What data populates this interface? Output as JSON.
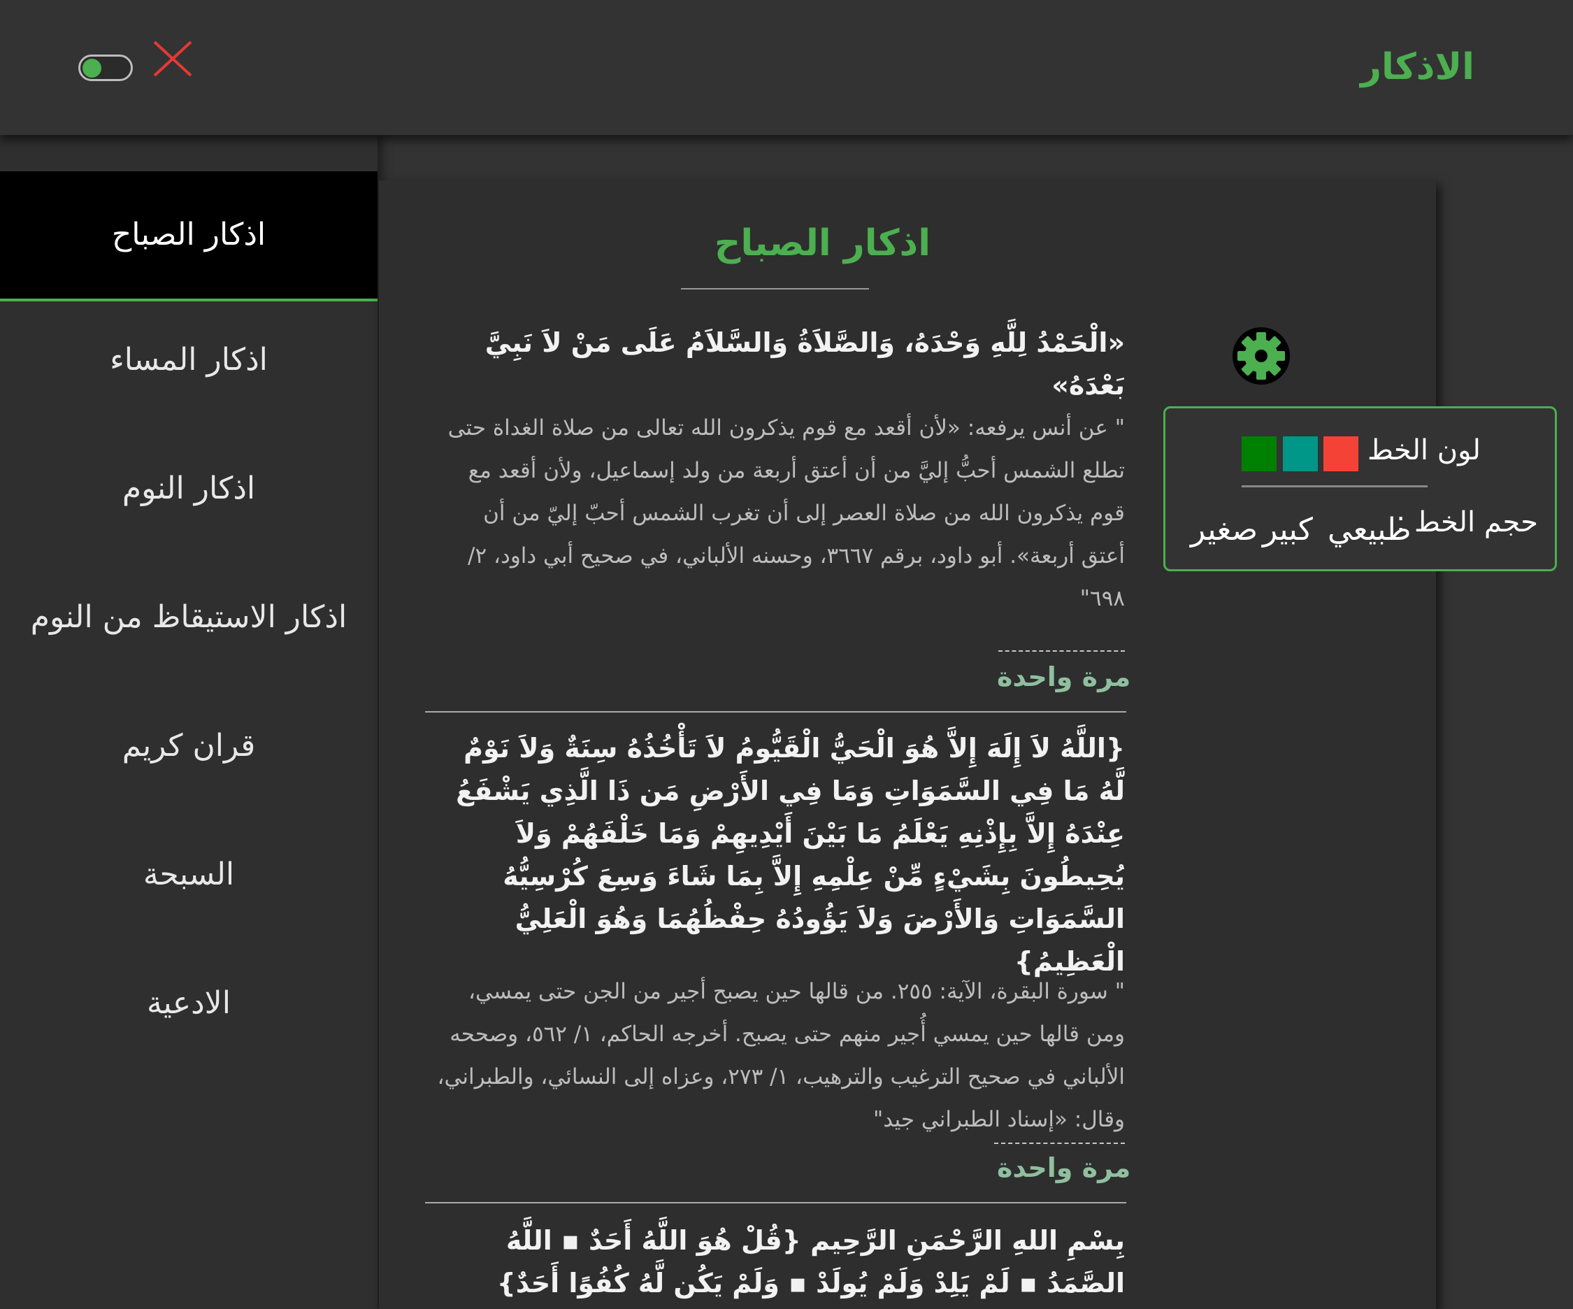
{
  "header": {
    "title": "الاذكار"
  },
  "sidebar": {
    "items": [
      {
        "label": "اذكار الصباح"
      },
      {
        "label": "اذكار المساء"
      },
      {
        "label": "اذكار النوم"
      },
      {
        "label": "اذكار الاستيقاظ من النوم"
      },
      {
        "label": "قران كريم"
      },
      {
        "label": "السبحة"
      },
      {
        "label": "الادعية"
      }
    ]
  },
  "main": {
    "title": "اذكار الصباح",
    "azkar": [
      {
        "text": "«الْحَمْدُ لِلَّهِ وَحْدَهُ، وَالصَّلاَةُ وَالسَّلاَمُ عَلَى مَنْ لاَ نَبِيَّ بَعْدَهُ»",
        "reference": "\" عن أنس يرفعه: «لأن أقعد مع قوم يذكرون الله تعالى من صلاة الغداة حتى تطلع الشمس أحبُّ إليَّ من أن أعتق أربعة من ولد إسماعيل، ولأن أقعد مع قوم يذكرون الله من صلاة العصر إلى أن تغرب الشمس أحبّ إليّ من أن أعتق أربعة». أبو داود، برقم ٣٦٦٧، وحسنه الألباني، في صحيح أبي داود، ٢/ ٦٩٨\"",
        "count": "مرة واحدة"
      },
      {
        "text": "{اللَّهُ لاَ إِلَهَ إِلاَّ هُوَ الْحَيُّ الْقَيُّومُ لاَ تَأْخُذُهُ سِنَةٌ وَلاَ نَوْمٌ لَّهُ مَا فِي السَّمَوَاتِ وَمَا فِي الأَرْضِ مَن ذَا الَّذِي يَشْفَعُ عِنْدَهُ إِلاَّ بِإِذْنِهِ يَعْلَمُ مَا بَيْنَ أَيْدِيهِمْ وَمَا خَلْفَهُمْ وَلاَ يُحِيطُونَ بِشَيْءٍ مِّنْ عِلْمِهِ إِلاَّ بِمَا شَاءَ وَسِعَ كُرْسِيُّهُ السَّمَوَاتِ وَالأَرْضَ وَلاَ يَؤُودُهُ حِفْظُهُمَا وَهُوَ الْعَلِيُّ الْعَظِيمُ}",
        "reference": "\" سورة البقرة، الآية: ٢٥٥. من قالها حين يصبح أجير من الجن حتى يمسي، ومن قالها حين يمسي أُجير منهم حتى يصبح. أخرجه الحاكم، ١/ ٥٦٢، وصححه الألباني في صحيح الترغيب والترهيب، ١/ ٢٧٣، وعزاه إلى النسائي، والطبراني، وقال: «إسناد الطبراني جيد\"",
        "count": "مرة واحدة"
      },
      {
        "text": "بِسْمِ اللهِ الرَّحْمَنِ الرَّحِيم {قُلْ هُوَ اللَّهُ أَحَدٌ ▪ اللَّهُ الصَّمَدُ ▪ لَمْ يَلِدْ وَلَمْ يُولَدْ ▪ وَلَمْ يَكُن لَّهُ كُفُوًا أَحَدٌ}"
      }
    ]
  },
  "settings": {
    "color_label": "لون الخط :",
    "size_label": "حجم الخط :",
    "colors": [
      "#008000",
      "#009688",
      "#f44336"
    ],
    "sizes": [
      "طبيعي",
      "كبير",
      "صغير"
    ]
  },
  "icons": [
    "toggle-switch",
    "close-icon",
    "gear-icon"
  ],
  "colors": {
    "accent": "#4caf50",
    "close": "#e53935",
    "background": "#333333"
  }
}
